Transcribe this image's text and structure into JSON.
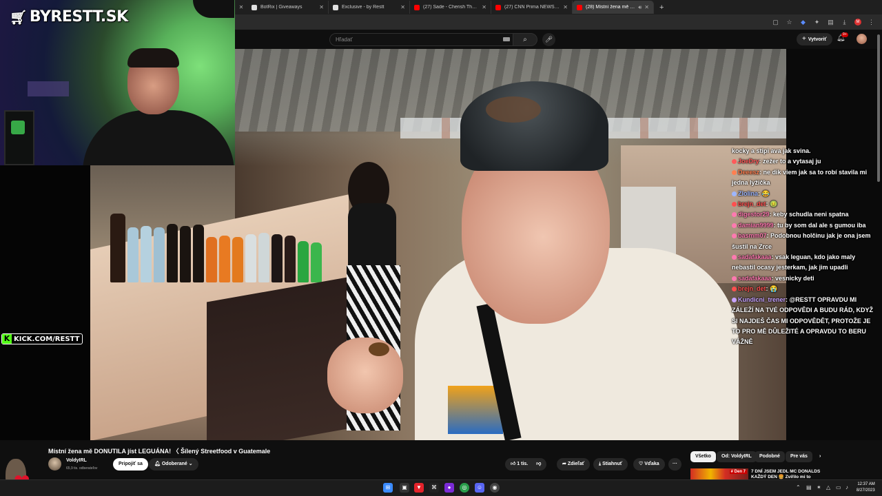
{
  "overlay": {
    "brand": "BYRESTT.SK",
    "kick": "KICK.COM/RESTT"
  },
  "browser": {
    "tabs": [
      {
        "label": "BotRix | Giveaways",
        "favicon": "#e0e0e0"
      },
      {
        "label": "Exclusive - by Restt",
        "favicon": "#e0e0e0"
      },
      {
        "label": "(27) Sade - Cherish The Day - Y",
        "favicon": "#ff0000"
      },
      {
        "label": "(27) CNN Prima NEWS - YouTube",
        "favicon": "#ff0000"
      },
      {
        "label": "(28) Místní žena mě DONUTILA",
        "favicon": "#ff0000",
        "active": true
      }
    ],
    "new_tab": "+"
  },
  "youtube": {
    "search_placeholder": "Hľadať",
    "create_label": "Vytvoriť",
    "bell_badge": "9+",
    "video_title": "Místní žena mě DONUTILA jíst LEGUÁNA! 〈 Šílený Streetfood v Guatemale",
    "channel_name": "VoldyIRL",
    "channel_subs": "65,9 tis. odberateľov",
    "join_label": "Pripojiť sa",
    "subscribed_label": "Odoberané",
    "like_count": "1 tis.",
    "share_label": "Zdieľať",
    "download_label": "Stiahnuť",
    "thanks_label": "Vďaka",
    "more_label": "···",
    "chips": [
      "Všetko",
      "Od: VoldyIRL",
      "Podobné",
      "Pre vás"
    ],
    "rec_title": "7 DNÍ JSEM JEDL MC DONALDS KAŽDÝ DEN 🍔 Zvířilo mi to",
    "rec_tag": "# Den 7"
  },
  "chat": [
    {
      "user": "",
      "color": "#ffffff",
      "text": "kocky a stipi ava jak svina."
    },
    {
      "user": "JoeDry",
      "color": "#ff5a5a",
      "text": "zežer to a vytasaj ju"
    },
    {
      "user": "Deeesz",
      "color": "#ff7f50",
      "text": "ne dik viem jak sa to robí stavila mi jedna lyžička"
    },
    {
      "user": "Zlolina",
      "color": "#9db6ff",
      "text": "😂"
    },
    {
      "user": "brejn_det",
      "color": "#ff4f4f",
      "text": "🤢"
    },
    {
      "user": "digestor29",
      "color": "#ff79b0",
      "text": "keby schudla neni spatna"
    },
    {
      "user": "damian9999",
      "color": "#ff79b0",
      "text": "tu by som dal ale s gumou iba"
    },
    {
      "user": "basmm07",
      "color": "#ff79b0",
      "text": "Podobnou holčinu jak je ona jsem šustil na Zrce"
    },
    {
      "user": "sadafakaaa",
      "color": "#ff79b0",
      "text": "vsak leguan, kdo jako maly nebastil ocasy jesterkam, jak jim upadli"
    },
    {
      "user": "sadafakaaa",
      "color": "#ff79b0",
      "text": "vesnicky deti"
    },
    {
      "user": "brejn_det",
      "color": "#ff4f4f",
      "text": "😭"
    },
    {
      "user": "Kundicni_trener",
      "color": "#c8a3ff",
      "text": "@RESTT OPRAVDU MI ZÁLEŽÍ NA TVÉ ODPOVĚDI A BUDU RÁD, KDYŽ SI NAJDEŠ ČAS MI ODPOVĚDĚT, PROTOŽE JE TO PRO MĚ DŮLEŽITÉ A OPRAVDU TO BERU VÁŽNĚ"
    }
  ],
  "taskbar": {
    "time": "12:37 AM",
    "date": "8/27/2023"
  }
}
